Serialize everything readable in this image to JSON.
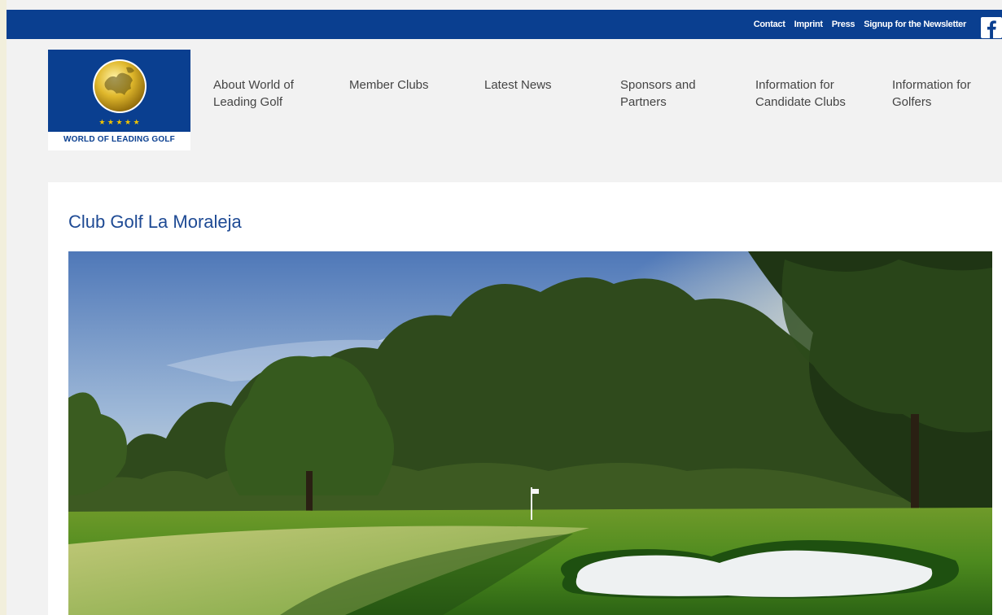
{
  "topbar": {
    "links": [
      "Contact",
      "Imprint",
      "Press",
      "Signup for the Newsletter"
    ],
    "social_icon": "facebook-icon",
    "color": "#0a3f90"
  },
  "logo": {
    "text": "WORLD OF LEADING GOLF",
    "stars": "★ ★ ★ ★ ★",
    "icon": "europe-globe-icon"
  },
  "nav": {
    "items": [
      {
        "line1": "About World of",
        "line2": "Leading Golf"
      },
      {
        "line1": "Member Clubs",
        "line2": ""
      },
      {
        "line1": "Latest News",
        "line2": ""
      },
      {
        "line1": "Sponsors and",
        "line2": "Partners"
      },
      {
        "line1": "Information for",
        "line2": "Candidate Clubs"
      },
      {
        "line1": "Information for",
        "line2": "Golfers"
      }
    ]
  },
  "main": {
    "title": "Club Golf La Moraleja",
    "title_color": "#1e4a94",
    "hero_image": "golf-course-photo"
  }
}
